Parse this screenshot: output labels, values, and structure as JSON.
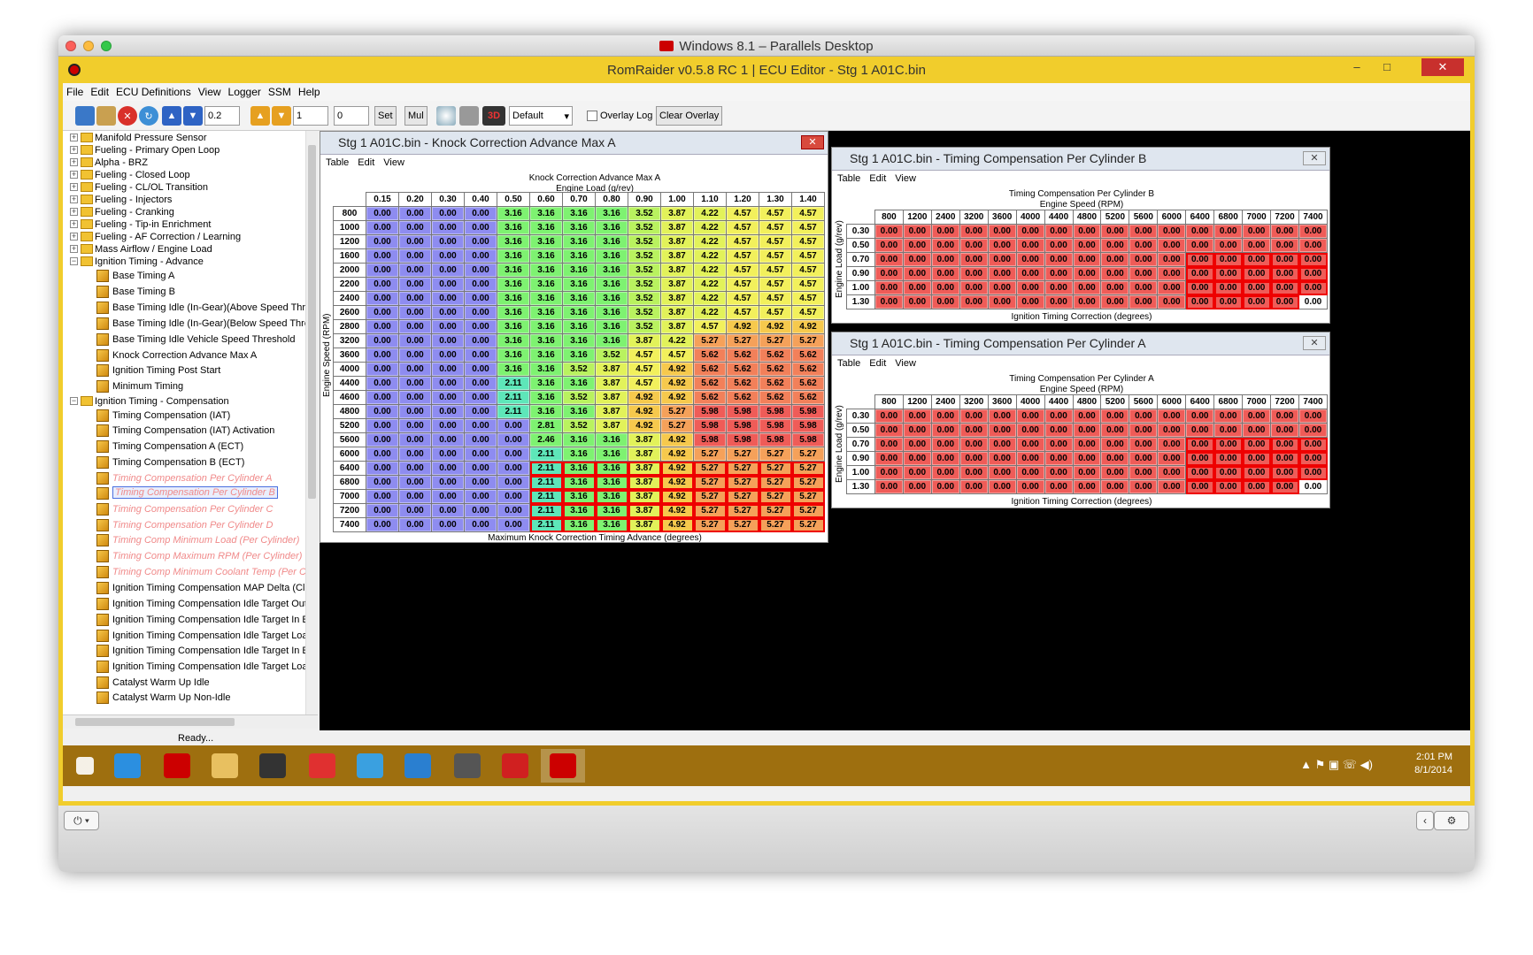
{
  "host": {
    "title": "Windows 8.1 – Parallels Desktop"
  },
  "app": {
    "title": "RomRaider v0.5.8 RC 1 | ECU Editor - Stg 1 A01C.bin",
    "menu": [
      "File",
      "Edit",
      "ECU Definitions",
      "View",
      "Logger",
      "SSM",
      "Help"
    ]
  },
  "toolbar": {
    "inc_value": "0.2",
    "mult_value": "1",
    "set_value": "0",
    "set_label": "Set",
    "mul_label": "Mul",
    "three_d_label": "3D",
    "compare_select": "Default",
    "overlay_log_label": "Overlay Log",
    "clear_overlay_label": "Clear Overlay"
  },
  "tree": [
    {
      "label": "Manifold Pressure Sensor",
      "kind": "category"
    },
    {
      "label": "Fueling - Primary Open Loop",
      "kind": "category"
    },
    {
      "label": "Alpha - BRZ",
      "kind": "category"
    },
    {
      "label": "Fueling - Closed Loop",
      "kind": "category"
    },
    {
      "label": "Fueling - CL/OL Transition",
      "kind": "category"
    },
    {
      "label": "Fueling - Injectors",
      "kind": "category"
    },
    {
      "label": "Fueling - Cranking",
      "kind": "category"
    },
    {
      "label": "Fueling - Tip-in Enrichment",
      "kind": "category"
    },
    {
      "label": "Fueling - AF Correction / Learning",
      "kind": "category"
    },
    {
      "label": "Mass Airflow / Engine Load",
      "kind": "category"
    },
    {
      "label": "Ignition Timing - Advance",
      "kind": "category-open"
    },
    {
      "label": "Base Timing A",
      "kind": "table"
    },
    {
      "label": "Base Timing B",
      "kind": "table"
    },
    {
      "label": "Base Timing Idle (In-Gear)(Above Speed Threshold)",
      "kind": "table"
    },
    {
      "label": "Base Timing Idle (In-Gear)(Below Speed Threshold)",
      "kind": "table"
    },
    {
      "label": "Base Timing Idle Vehicle Speed Threshold",
      "kind": "table"
    },
    {
      "label": "Knock Correction Advance Max A",
      "kind": "table"
    },
    {
      "label": "Ignition Timing Post Start",
      "kind": "table"
    },
    {
      "label": "Minimum Timing",
      "kind": "table"
    },
    {
      "label": "Ignition Timing - Compensation",
      "kind": "category-open"
    },
    {
      "label": "Timing Compensation (IAT)",
      "kind": "table"
    },
    {
      "label": "Timing Compensation (IAT) Activation",
      "kind": "table"
    },
    {
      "label": "Timing Compensation A (ECT)",
      "kind": "table"
    },
    {
      "label": "Timing Compensation B (ECT)",
      "kind": "table"
    },
    {
      "label": "Timing Compensation Per Cylinder A",
      "kind": "table-faded"
    },
    {
      "label": "Timing Compensation Per Cylinder B",
      "kind": "table-selected"
    },
    {
      "label": "Timing Compensation Per Cylinder C",
      "kind": "table-faded"
    },
    {
      "label": "Timing Compensation Per Cylinder D",
      "kind": "table-faded"
    },
    {
      "label": "Timing Comp Minimum Load (Per Cylinder)",
      "kind": "table-faded"
    },
    {
      "label": "Timing Comp Maximum RPM (Per Cylinder)",
      "kind": "table-faded"
    },
    {
      "label": "Timing Comp Minimum Coolant Temp (Per Cylinder)",
      "kind": "table-faded"
    },
    {
      "label": "Ignition Timing Compensation MAP Delta (Clutch De",
      "kind": "table"
    },
    {
      "label": "Ignition Timing Compensation Idle Target Out of Er",
      "kind": "table"
    },
    {
      "label": "Ignition Timing Compensation Idle Target In Error F",
      "kind": "table"
    },
    {
      "label": "Ignition Timing Compensation Idle Target Load Cha",
      "kind": "table"
    },
    {
      "label": "Ignition Timing Compensation Idle Target In Error F",
      "kind": "table"
    },
    {
      "label": "Ignition Timing Compensation Idle Target Load Cha",
      "kind": "table"
    },
    {
      "label": "Catalyst Warm Up Idle",
      "kind": "table"
    },
    {
      "label": "Catalyst Warm Up Non-Idle",
      "kind": "table"
    }
  ],
  "status": "Ready...",
  "knock_table": {
    "window_title": "Stg 1 A01C.bin - Knock Correction Advance Max A",
    "menu": [
      "Table",
      "Edit",
      "View"
    ],
    "title": "Knock Correction Advance Max A",
    "xlabel": "Engine Load (g/rev)",
    "ylabel": "Engine Speed (RPM)",
    "zlabel": "Maximum Knock Correction Timing Advance (degrees)",
    "x": [
      "0.15",
      "0.20",
      "0.30",
      "0.40",
      "0.50",
      "0.60",
      "0.70",
      "0.80",
      "0.90",
      "1.00",
      "1.10",
      "1.20",
      "1.30",
      "1.40"
    ],
    "y": [
      "800",
      "1000",
      "1200",
      "1600",
      "2000",
      "2200",
      "2400",
      "2600",
      "2800",
      "3200",
      "3600",
      "4000",
      "4400",
      "4600",
      "4800",
      "5200",
      "5600",
      "6000",
      "6400",
      "6800",
      "7000",
      "7200",
      "7400"
    ],
    "rows": [
      [
        "0.00",
        "0.00",
        "0.00",
        "0.00",
        "3.16",
        "3.16",
        "3.16",
        "3.16",
        "3.52",
        "3.87",
        "4.22",
        "4.57",
        "4.57",
        "4.57"
      ],
      [
        "0.00",
        "0.00",
        "0.00",
        "0.00",
        "3.16",
        "3.16",
        "3.16",
        "3.16",
        "3.52",
        "3.87",
        "4.22",
        "4.57",
        "4.57",
        "4.57"
      ],
      [
        "0.00",
        "0.00",
        "0.00",
        "0.00",
        "3.16",
        "3.16",
        "3.16",
        "3.16",
        "3.52",
        "3.87",
        "4.22",
        "4.57",
        "4.57",
        "4.57"
      ],
      [
        "0.00",
        "0.00",
        "0.00",
        "0.00",
        "3.16",
        "3.16",
        "3.16",
        "3.16",
        "3.52",
        "3.87",
        "4.22",
        "4.57",
        "4.57",
        "4.57"
      ],
      [
        "0.00",
        "0.00",
        "0.00",
        "0.00",
        "3.16",
        "3.16",
        "3.16",
        "3.16",
        "3.52",
        "3.87",
        "4.22",
        "4.57",
        "4.57",
        "4.57"
      ],
      [
        "0.00",
        "0.00",
        "0.00",
        "0.00",
        "3.16",
        "3.16",
        "3.16",
        "3.16",
        "3.52",
        "3.87",
        "4.22",
        "4.57",
        "4.57",
        "4.57"
      ],
      [
        "0.00",
        "0.00",
        "0.00",
        "0.00",
        "3.16",
        "3.16",
        "3.16",
        "3.16",
        "3.52",
        "3.87",
        "4.22",
        "4.57",
        "4.57",
        "4.57"
      ],
      [
        "0.00",
        "0.00",
        "0.00",
        "0.00",
        "3.16",
        "3.16",
        "3.16",
        "3.16",
        "3.52",
        "3.87",
        "4.22",
        "4.57",
        "4.57",
        "4.57"
      ],
      [
        "0.00",
        "0.00",
        "0.00",
        "0.00",
        "3.16",
        "3.16",
        "3.16",
        "3.16",
        "3.52",
        "3.87",
        "4.57",
        "4.92",
        "4.92",
        "4.92"
      ],
      [
        "0.00",
        "0.00",
        "0.00",
        "0.00",
        "3.16",
        "3.16",
        "3.16",
        "3.16",
        "3.87",
        "4.22",
        "5.27",
        "5.27",
        "5.27",
        "5.27"
      ],
      [
        "0.00",
        "0.00",
        "0.00",
        "0.00",
        "3.16",
        "3.16",
        "3.16",
        "3.52",
        "4.57",
        "4.57",
        "5.62",
        "5.62",
        "5.62",
        "5.62"
      ],
      [
        "0.00",
        "0.00",
        "0.00",
        "0.00",
        "3.16",
        "3.16",
        "3.52",
        "3.87",
        "4.57",
        "4.92",
        "5.62",
        "5.62",
        "5.62",
        "5.62"
      ],
      [
        "0.00",
        "0.00",
        "0.00",
        "0.00",
        "2.11",
        "3.16",
        "3.16",
        "3.87",
        "4.57",
        "4.92",
        "5.62",
        "5.62",
        "5.62",
        "5.62"
      ],
      [
        "0.00",
        "0.00",
        "0.00",
        "0.00",
        "2.11",
        "3.16",
        "3.52",
        "3.87",
        "4.92",
        "4.92",
        "5.62",
        "5.62",
        "5.62",
        "5.62"
      ],
      [
        "0.00",
        "0.00",
        "0.00",
        "0.00",
        "2.11",
        "3.16",
        "3.16",
        "3.87",
        "4.92",
        "5.27",
        "5.98",
        "5.98",
        "5.98",
        "5.98"
      ],
      [
        "0.00",
        "0.00",
        "0.00",
        "0.00",
        "0.00",
        "2.81",
        "3.52",
        "3.87",
        "4.92",
        "5.27",
        "5.98",
        "5.98",
        "5.98",
        "5.98"
      ],
      [
        "0.00",
        "0.00",
        "0.00",
        "0.00",
        "0.00",
        "2.46",
        "3.16",
        "3.16",
        "3.87",
        "4.92",
        "5.98",
        "5.98",
        "5.98",
        "5.98"
      ],
      [
        "0.00",
        "0.00",
        "0.00",
        "0.00",
        "0.00",
        "2.11",
        "3.16",
        "3.16",
        "3.87",
        "4.92",
        "5.27",
        "5.27",
        "5.27",
        "5.27"
      ],
      [
        "0.00",
        "0.00",
        "0.00",
        "0.00",
        "0.00",
        "2.11",
        "3.16",
        "3.16",
        "3.87",
        "4.92",
        "5.27",
        "5.27",
        "5.27",
        "5.27"
      ],
      [
        "0.00",
        "0.00",
        "0.00",
        "0.00",
        "0.00",
        "2.11",
        "3.16",
        "3.16",
        "3.87",
        "4.92",
        "5.27",
        "5.27",
        "5.27",
        "5.27"
      ],
      [
        "0.00",
        "0.00",
        "0.00",
        "0.00",
        "0.00",
        "2.11",
        "3.16",
        "3.16",
        "3.87",
        "4.92",
        "5.27",
        "5.27",
        "5.27",
        "5.27"
      ],
      [
        "0.00",
        "0.00",
        "0.00",
        "0.00",
        "0.00",
        "2.11",
        "3.16",
        "3.16",
        "3.87",
        "4.92",
        "5.27",
        "5.27",
        "5.27",
        "5.27"
      ],
      [
        "0.00",
        "0.00",
        "0.00",
        "0.00",
        "0.00",
        "2.11",
        "3.16",
        "3.16",
        "3.87",
        "4.92",
        "5.27",
        "5.27",
        "5.27",
        "5.27"
      ]
    ]
  },
  "cyl_b": {
    "window_title": "Stg 1 A01C.bin - Timing Compensation Per Cylinder B",
    "menu": [
      "Table",
      "Edit",
      "View"
    ],
    "title": "Timing Compensation Per Cylinder B",
    "xlabel": "Engine Speed (RPM)",
    "ylabel": "Engine Load (g/rev)",
    "zlabel": "Ignition Timing Correction (degrees)",
    "x": [
      "800",
      "1200",
      "2400",
      "3200",
      "3600",
      "4000",
      "4400",
      "4800",
      "5200",
      "5600",
      "6000",
      "6400",
      "6800",
      "7000",
      "7200",
      "7400"
    ],
    "y": [
      "0.30",
      "0.50",
      "0.70",
      "0.90",
      "1.00",
      "1.30"
    ],
    "cell_value": "0.00"
  },
  "cyl_a": {
    "window_title": "Stg 1 A01C.bin - Timing Compensation Per Cylinder A",
    "menu": [
      "Table",
      "Edit",
      "View"
    ],
    "title": "Timing Compensation Per Cylinder A",
    "xlabel": "Engine Speed (RPM)",
    "ylabel": "Engine Load (g/rev)",
    "zlabel": "Ignition Timing Correction (degrees)",
    "x": [
      "800",
      "1200",
      "2400",
      "3200",
      "3600",
      "4000",
      "4400",
      "4800",
      "5200",
      "5600",
      "6000",
      "6400",
      "6800",
      "7000",
      "7200",
      "7400"
    ],
    "y": [
      "0.30",
      "0.50",
      "0.70",
      "0.90",
      "1.00",
      "1.30"
    ],
    "cell_value": "0.00"
  },
  "taskbar": {
    "time": "2:01 PM",
    "date": "8/1/2014",
    "apps": [
      "start-icon",
      "ie-icon",
      "romraider-icon",
      "explorer-icon",
      "chip-icon",
      "logger-icon",
      "procede-icon",
      "app-icon",
      "gauge-icon",
      "car-icon",
      "romraider-active-icon"
    ]
  },
  "colors": {
    "blue": "#8e8cf0",
    "green": "#7ef271",
    "yellow": "#f2f05c",
    "orange": "#f5a15a",
    "red": "#ef5c58",
    "gold": "#f1cd2c",
    "taskbar": "#9e6f0f"
  }
}
